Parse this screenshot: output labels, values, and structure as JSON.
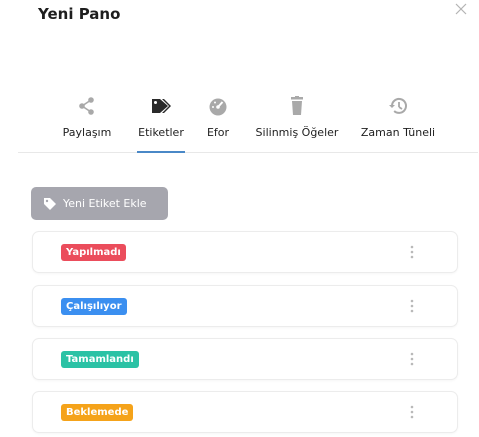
{
  "dialog": {
    "title": "Yeni Pano"
  },
  "tabs": [
    {
      "label": "Paylaşım",
      "icon": "share-icon"
    },
    {
      "label": "Etiketler",
      "icon": "tag-icon",
      "active": true
    },
    {
      "label": "Efor",
      "icon": "speedometer-icon"
    },
    {
      "label": "Silinmiş Öğeler",
      "icon": "trash-icon"
    },
    {
      "label": "Zaman Tüneli",
      "icon": "history-icon"
    }
  ],
  "add_button": {
    "label": "Yeni Etiket Ekle",
    "icon": "tag-icon"
  },
  "labels": [
    {
      "name": "Yapılmadı",
      "color": "#eb4d5c"
    },
    {
      "name": "Çalışılıyor",
      "color": "#3b8ff0"
    },
    {
      "name": "Tamamlandı",
      "color": "#2bc2a5"
    },
    {
      "name": "Beklemede",
      "color": "#f5a31a"
    }
  ],
  "colors": {
    "icon_gray": "#a9a9a9",
    "icon_active": "#2a2a2a",
    "tab_underline": "#4a88c7",
    "button_bg": "#a6a6ae"
  }
}
